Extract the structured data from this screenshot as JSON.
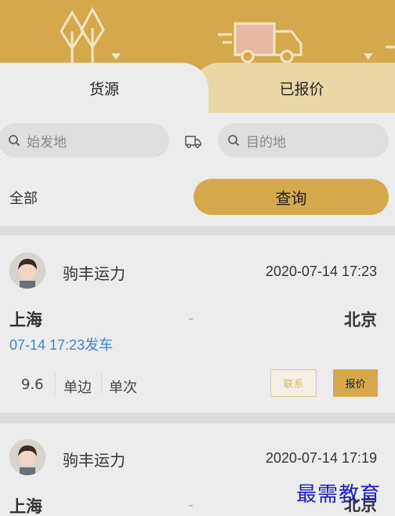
{
  "tabs": [
    {
      "label": "货源",
      "active": true
    },
    {
      "label": "已报价",
      "active": false
    }
  ],
  "search": {
    "origin_placeholder": "始发地",
    "destination_placeholder": "目的地",
    "filter_all": "全部",
    "query_label": "查询"
  },
  "cards": [
    {
      "company": "驹丰运力",
      "time": "2020-07-14 17:23",
      "from": "上海",
      "to": "北京",
      "dash": "–",
      "depart": "07-14 17:23发车",
      "specs": [
        "9.6",
        "单边",
        "单次"
      ],
      "contact_label": "联系",
      "quote_label": "报价"
    },
    {
      "company": "驹丰运力",
      "time": "2020-07-14 17:19",
      "from": "上海",
      "to": "北京",
      "dash": "–"
    }
  ],
  "watermark": "最需教育",
  "colors": {
    "accent": "#d6a84c",
    "tab_inactive": "#e9d7a6",
    "link_blue": "#3f86d8"
  },
  "icons": [
    "tree-icon",
    "truck-icon",
    "search-icon",
    "swap-truck-icon"
  ]
}
